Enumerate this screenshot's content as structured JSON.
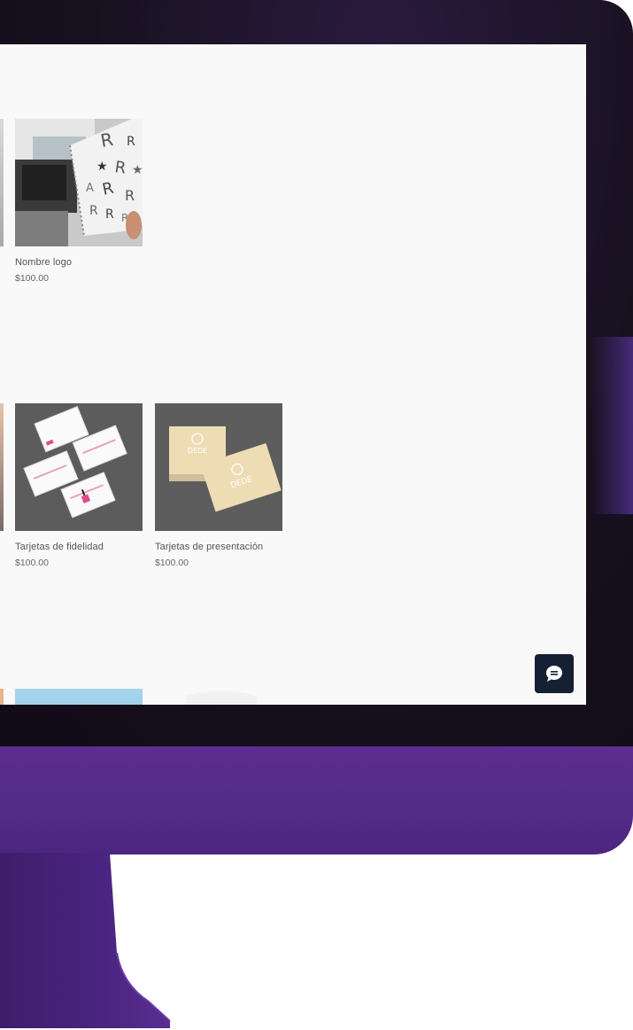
{
  "products": [
    {
      "name": "Nombre logo",
      "price": "$100.00",
      "image_icon": "logo-sketch-image"
    },
    {
      "name": "Tarjetas de fidelidad",
      "price": "$100.00",
      "image_icon": "loyalty-cards-image"
    },
    {
      "name": "Tarjetas de presentación",
      "price": "$100.00",
      "image_icon": "business-cards-image"
    }
  ],
  "chat": {
    "icon": "chat-icon"
  },
  "colors": {
    "frame_purple": "#5b2d8f",
    "bezel_dark": "#17111f",
    "chat_button": "#152033",
    "page_background": "#f9f9f9"
  }
}
